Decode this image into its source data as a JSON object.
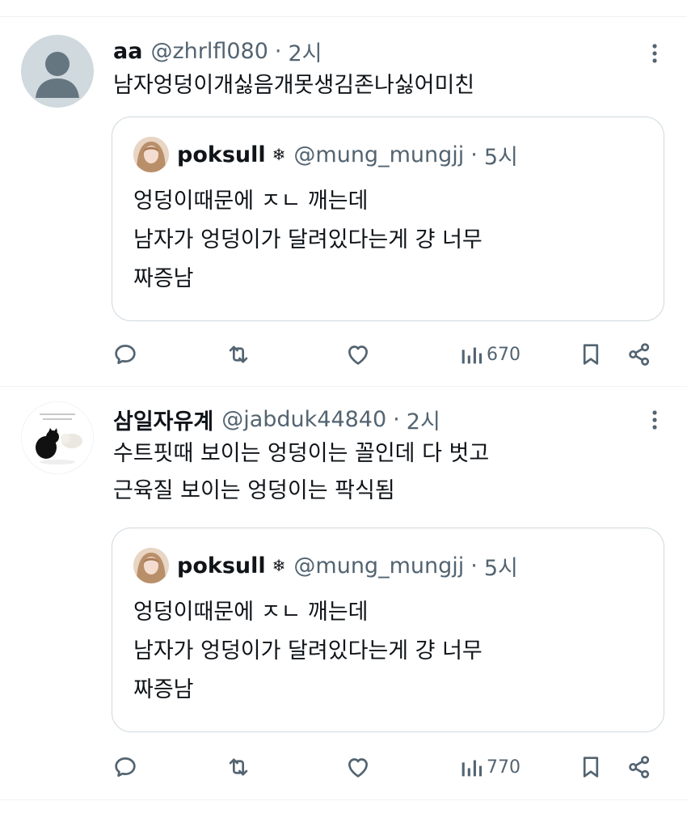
{
  "posts": [
    {
      "name": "aa",
      "handle": "@zhrlfl080",
      "dot": "·",
      "time": "2시",
      "text_lines": [
        "남자엉덩이개싫음개못생김존나싫어미친"
      ],
      "quote": {
        "name": "poksull",
        "badge": "❄",
        "handle": "@mung_mungjj",
        "dot": "·",
        "time": "5시",
        "text_lines": [
          "엉덩이때문에 ㅈㄴ 깨는데",
          "남자가 엉덩이가 달려있다는게 걍 너무",
          "짜증남"
        ]
      },
      "views": "670"
    },
    {
      "name": "삼일자유계",
      "handle": "@jabduk44840",
      "dot": "·",
      "time": "2시",
      "text_lines": [
        "수트핏때 보이는 엉덩이는 꼴인데 다 벗고",
        "근육질 보이는 엉덩이는 팍식됨"
      ],
      "quote": {
        "name": "poksull",
        "badge": "❄",
        "handle": "@mung_mungjj",
        "dot": "·",
        "time": "5시",
        "text_lines": [
          "엉덩이때문에 ㅈㄴ 깨는데",
          "남자가 엉덩이가 달려있다는게 걍 너무",
          "짜증남"
        ]
      },
      "views": "770"
    }
  ],
  "icons": {
    "more": "more-dots-icon",
    "reply": "reply-icon",
    "repost": "repost-icon",
    "like": "like-icon",
    "views": "views-icon",
    "bookmark": "bookmark-icon",
    "share": "share-icon"
  },
  "colors": {
    "text_primary": "#0f1419",
    "text_secondary": "#536471",
    "border": "#cfd9de",
    "divider": "#eff3f4"
  }
}
